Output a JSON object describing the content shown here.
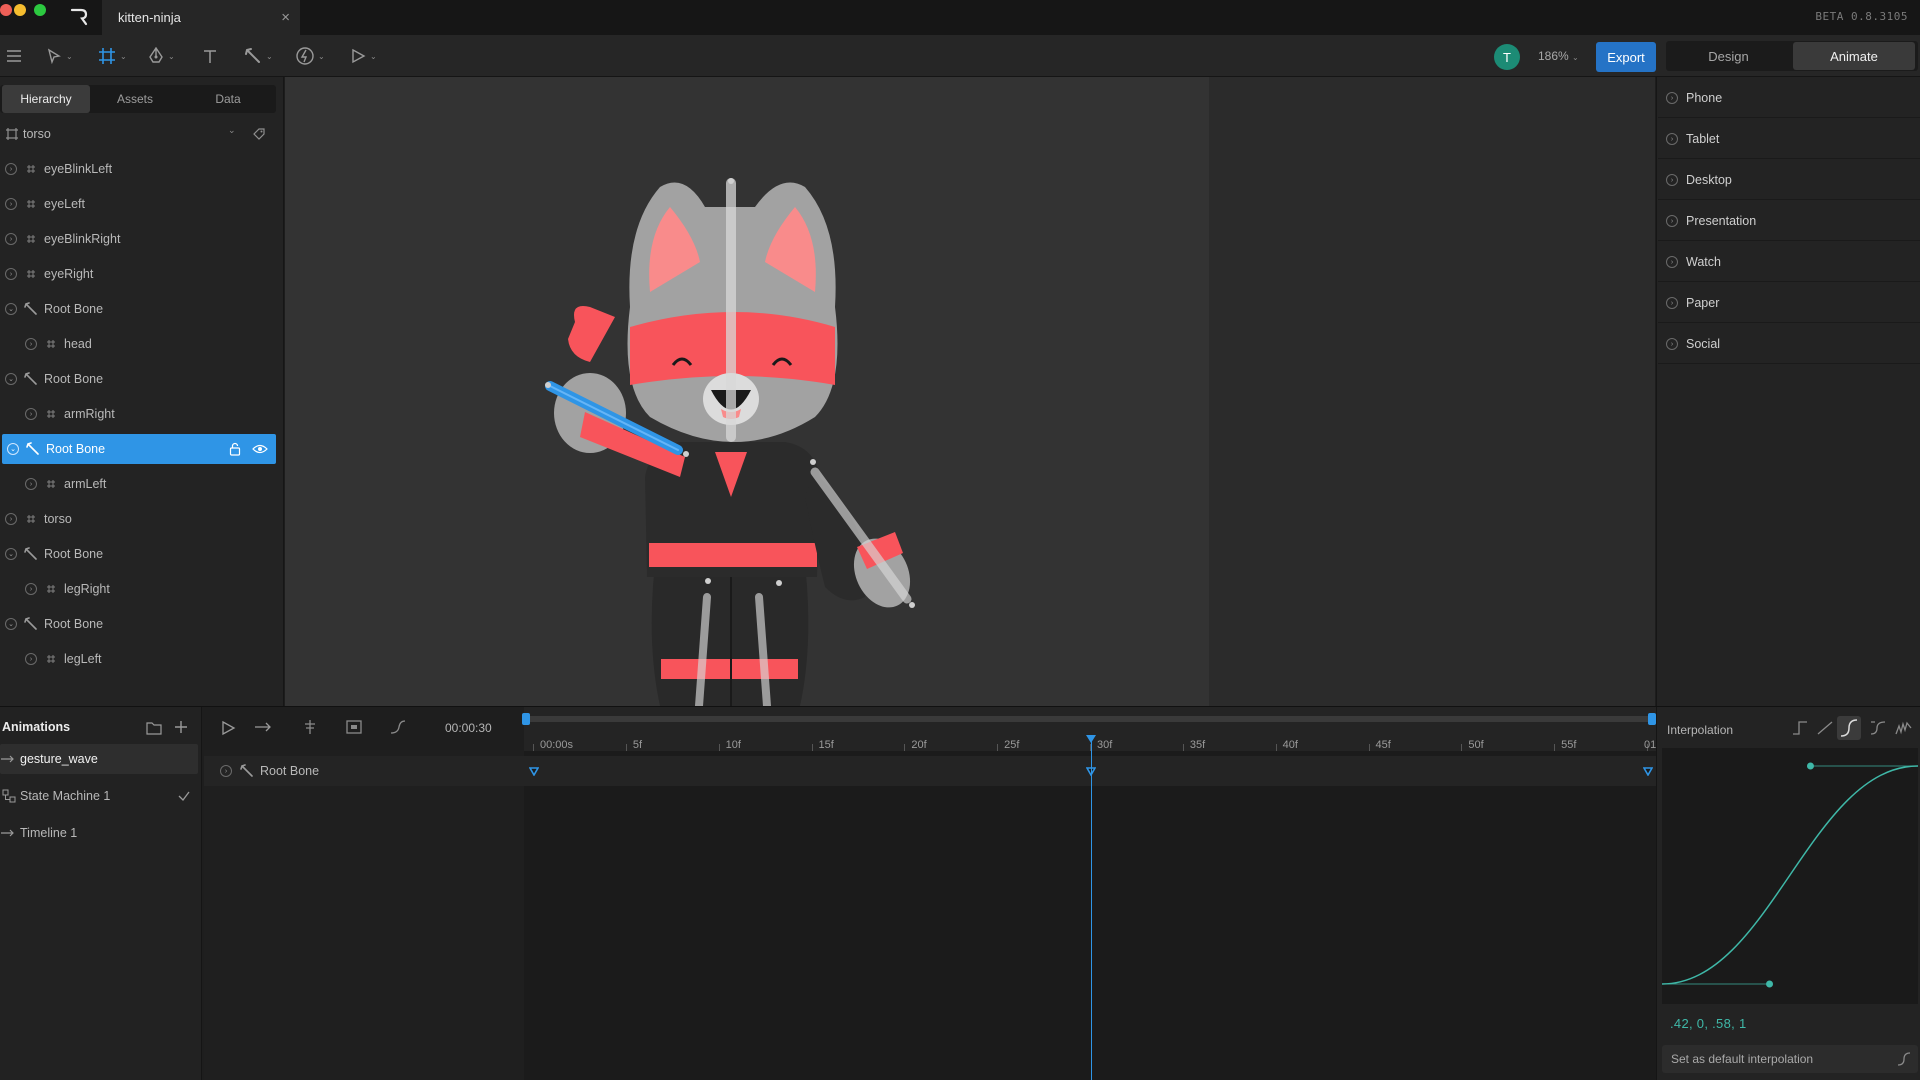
{
  "window": {
    "tab_title": "kitten-ninja",
    "close_glyph": "×",
    "version": "BETA 0.8.3105"
  },
  "toolbar": {
    "avatar_initial": "T",
    "zoom": "186%",
    "caret": "⌄",
    "export_label": "Export",
    "mode_design": "Design",
    "mode_animate": "Animate"
  },
  "left_panel": {
    "tabs": [
      "Hierarchy",
      "Assets",
      "Data"
    ],
    "artboard": "torso",
    "tree": [
      {
        "label": "eyeBlinkLeft",
        "type": "group",
        "depth": 0,
        "expanded": false
      },
      {
        "label": "eyeLeft",
        "type": "group",
        "depth": 0,
        "expanded": false
      },
      {
        "label": "eyeBlinkRight",
        "type": "group",
        "depth": 0,
        "expanded": false
      },
      {
        "label": "eyeRight",
        "type": "group",
        "depth": 0,
        "expanded": false
      },
      {
        "label": "Root Bone",
        "type": "bone",
        "depth": 0,
        "expanded": true
      },
      {
        "label": "head",
        "type": "group",
        "depth": 1,
        "expanded": false
      },
      {
        "label": "Root Bone",
        "type": "bone",
        "depth": 0,
        "expanded": true
      },
      {
        "label": "armRight",
        "type": "group",
        "depth": 1,
        "expanded": false
      },
      {
        "label": "Root Bone",
        "type": "bone",
        "depth": 0,
        "expanded": true,
        "selected": true
      },
      {
        "label": "armLeft",
        "type": "group",
        "depth": 1,
        "expanded": false
      },
      {
        "label": "torso",
        "type": "group",
        "depth": 0,
        "expanded": false
      },
      {
        "label": "Root Bone",
        "type": "bone",
        "depth": 0,
        "expanded": true
      },
      {
        "label": "legRight",
        "type": "group",
        "depth": 1,
        "expanded": false
      },
      {
        "label": "Root Bone",
        "type": "bone",
        "depth": 0,
        "expanded": true
      },
      {
        "label": "legLeft",
        "type": "group",
        "depth": 1,
        "expanded": false
      }
    ]
  },
  "right_panel": {
    "devices": [
      "Phone",
      "Tablet",
      "Desktop",
      "Presentation",
      "Watch",
      "Paper",
      "Social"
    ]
  },
  "animations": {
    "title": "Animations",
    "items": [
      {
        "label": "gesture_wave",
        "kind": "linear",
        "active": true
      },
      {
        "label": "State Machine 1",
        "kind": "state-machine",
        "checked": true
      },
      {
        "label": "Timeline 1",
        "kind": "linear",
        "active": false
      }
    ]
  },
  "timeline": {
    "time": "00:00:30",
    "ruler_labels": [
      "00:00s",
      "5f",
      "10f",
      "15f",
      "20f",
      "25f",
      "30f",
      "35f",
      "40f",
      "45f",
      "50f",
      "55f",
      "01:00"
    ],
    "track_label": "Root Bone",
    "playhead_frame": 30,
    "keyframes": [
      0,
      30,
      60
    ],
    "total_frames": 60
  },
  "interpolation": {
    "title": "Interpolation",
    "cubic_text": ".42, 0, .58, 1",
    "cubic": [
      0.42,
      0,
      0.58,
      1
    ],
    "default_label": "Set as default interpolation",
    "curve_color": "#3fb8a8"
  },
  "colors": {
    "accent": "#2f95e6",
    "export": "#2573c6",
    "ninja_red": "#f8545b",
    "kitten_gray": "#a2a2a2"
  }
}
